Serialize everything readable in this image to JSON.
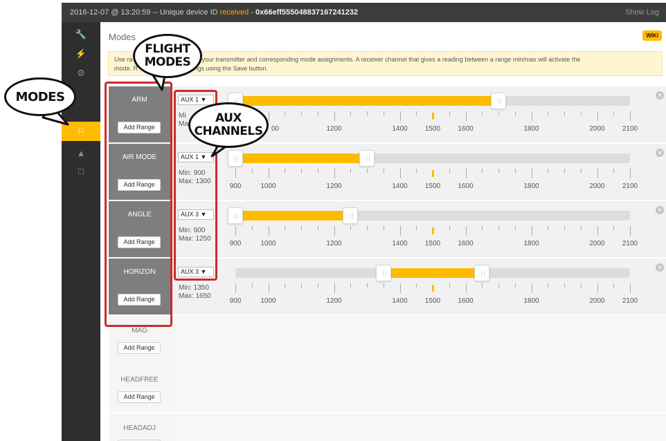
{
  "logbar": {
    "date": "2016-12-07 @ 13:20:59 -- Unique device ID ",
    "received": "received",
    "dash": " - ",
    "uid": "0x66eff555048837167241232",
    "show_log": "Show Log"
  },
  "nav": {
    "items": [
      "wrench-icon",
      "plug-icon",
      "gear-icon",
      "",
      "",
      "toggle-icon",
      "motor-icon",
      "monitor-icon"
    ]
  },
  "page": {
    "title": "Modes",
    "wiki": "WIKI",
    "notice_line1": "Use ra                                   on your transmitter and corresponding mode assignments. A receiver channel that gives a reading between a range min/max will activate the",
    "notice_line2": "mode. R                          settings using the Save button."
  },
  "range_button": "Add Range",
  "modes": [
    {
      "name": "ARM",
      "channel": "AUX 1 ▼",
      "min": "Mi",
      "max": "Ma",
      "fill": [
        900,
        1700
      ]
    },
    {
      "name": "AIR MODE",
      "channel": "AUX 1 ▼",
      "min": "Min: 900",
      "max": "Max: 1300",
      "fill": [
        900,
        1300
      ]
    },
    {
      "name": "ANGLE",
      "channel": "AUX 3 ▼",
      "min": "Min: 900",
      "max": "Max: 1250",
      "fill": [
        900,
        1250
      ]
    },
    {
      "name": "HORIZON",
      "channel": "AUX 3 ▼",
      "min": "Min: 1350",
      "max": "Max: 1650",
      "fill": [
        1350,
        1650
      ]
    }
  ],
  "inactive_modes": [
    "MAG",
    "HEADFREE",
    "HEADADJ"
  ],
  "scale": {
    "labels": [
      "900",
      "1000",
      "1200",
      "1400",
      "1500",
      "1600",
      "1800",
      "2000",
      "2100"
    ],
    "values": [
      900,
      1000,
      1200,
      1400,
      1500,
      1600,
      1800,
      2000,
      2100
    ],
    "first_row_labels": [
      "1200",
      "1400",
      "1500",
      "1600",
      "1800",
      "2000",
      "2100"
    ],
    "first_row_values": [
      1200,
      1400,
      1500,
      1600,
      1800,
      2000,
      2100
    ],
    "first_row_partial": "00",
    "current": 1500
  },
  "callouts": {
    "modes": "MODES",
    "flight_modes_1": "FLIGHT",
    "flight_modes_2": "MODES",
    "aux_1": "AUX",
    "aux_2": "CHANNELS"
  },
  "colors": {
    "accent": "#ffbb00",
    "highlight": "#cc2b2b"
  }
}
